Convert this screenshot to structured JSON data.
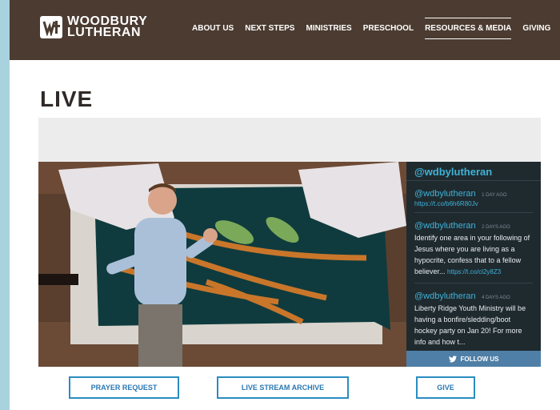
{
  "header": {
    "logo_line1": "WOODBURY",
    "logo_line2": "LUTHERAN",
    "nav": [
      "ABOUT US",
      "NEXT STEPS",
      "MINISTRIES",
      "PRESCHOOL",
      "RESOURCES & MEDIA",
      "GIVING"
    ],
    "active_nav": "RESOURCES & MEDIA"
  },
  "page_title": "LIVE",
  "twitter": {
    "handle": "@wdbylutheran",
    "tweets": [
      {
        "user": "@wdbylutheran",
        "time": "1 DAY AGO",
        "link": "https://t.co/b6h6R80Jv",
        "text": ""
      },
      {
        "user": "@wdbylutheran",
        "time": "2 DAYS AGO",
        "text": "Identify one area in your following of Jesus where you are living as a hypocrite, confess that to a fellow believer...",
        "link": "https://t.co/cl2y8Z3"
      },
      {
        "user": "@wdbylutheran",
        "time": "4 DAYS AGO",
        "text": "Liberty Ridge Youth Ministry will be having a bonfire/sledding/boot hockey party on Jan 20! For more info and how t...",
        "link": ""
      }
    ],
    "follow_label": "FOLLOW US"
  },
  "buttons": {
    "prayer_request": "PRAYER REQUEST",
    "archive": "LIVE STREAM ARCHIVE",
    "give": "GIVE"
  },
  "colors": {
    "header_bg": "#4b3b30",
    "accent_blue": "#2a8cc1",
    "twitter_bg": "#1f2a2f"
  }
}
